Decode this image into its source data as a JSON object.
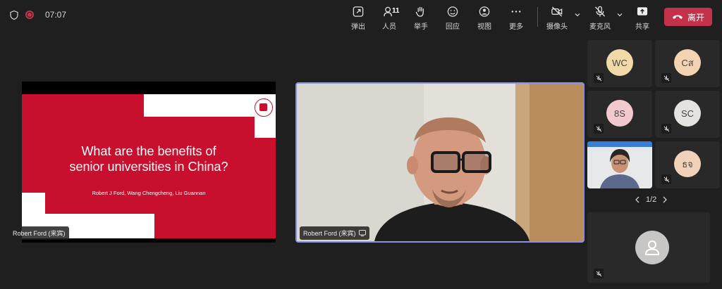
{
  "status": {
    "timer": "07:07"
  },
  "toolbar": {
    "popout": "弹出",
    "people": "人员",
    "people_count": "11",
    "raise_hand": "举手",
    "react": "回应",
    "view": "视图",
    "more": "更多",
    "camera": "摄像头",
    "mic": "麦克风",
    "share": "共享",
    "leave": "离开"
  },
  "slide": {
    "title_line1": "What are the benefits of",
    "title_line2": "senior universities in China?",
    "authors": "Robert J Ford, Wang Chengcheng, Liu Guannan",
    "presenter_label": "Robert Ford (来宾)"
  },
  "video": {
    "label": "Robert Ford (来宾)"
  },
  "participants": [
    {
      "initials": "WC",
      "color": "#f1d9a8"
    },
    {
      "initials": "Cส",
      "color": "#f3d3b2"
    },
    {
      "initials": "8S",
      "color": "#f2c9cc"
    },
    {
      "initials": "SC",
      "color": "#e6e2de"
    },
    {
      "initials": "ธจ",
      "color": "#f1d2b8"
    }
  ],
  "pager": {
    "label": "1/2"
  }
}
